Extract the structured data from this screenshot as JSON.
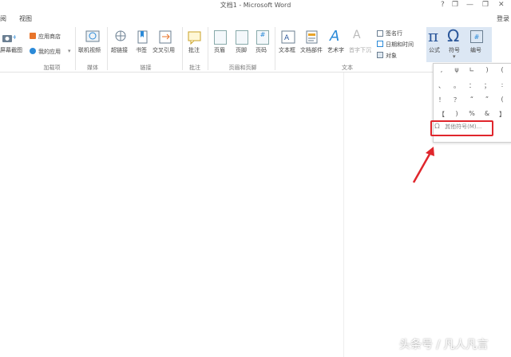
{
  "window": {
    "title": "文档1 - Microsoft Word",
    "help": "?",
    "minimize": "—",
    "restore": "❐",
    "close": "✕",
    "login": "登录"
  },
  "tabs": [
    "阅",
    "视图"
  ],
  "ribbon": {
    "screenshot": "屏幕截图",
    "app_store": "应用商店",
    "my_apps": "我的应用",
    "online_video": "联机视频",
    "hyperlink": "超链接",
    "bookmark": "书签",
    "cross_ref": "交叉引用",
    "comment": "批注",
    "header": "页眉",
    "footer": "页脚",
    "page_number": "页码",
    "textbox": "文本框",
    "quick_parts": "文档部件",
    "wordart": "艺术字",
    "dropcap": "首字下沉",
    "signature_line": "签名行",
    "datetime": "日期和时间",
    "object": "对象",
    "equation": "公式",
    "symbol": "符号",
    "numbering": "编号",
    "groups": {
      "addins": "加载项",
      "media": "媒体",
      "links": "链接",
      "comments": "批注",
      "header_footer": "页眉和页脚",
      "text": "文本"
    }
  },
  "symbol_menu": {
    "symbols": [
      ",",
      "ψ",
      "∟",
      ")",
      "(",
      "、",
      "。",
      "：",
      "；",
      ":",
      "！",
      "？",
      "“",
      "”",
      "(",
      "【",
      ")",
      "%",
      "&",
      "】"
    ],
    "more_symbols": "其他符号(M)..."
  },
  "watermark": "头条号 / 凡人凡言",
  "colors": {
    "highlight": "#e0262c",
    "accent": "#2b579a"
  }
}
